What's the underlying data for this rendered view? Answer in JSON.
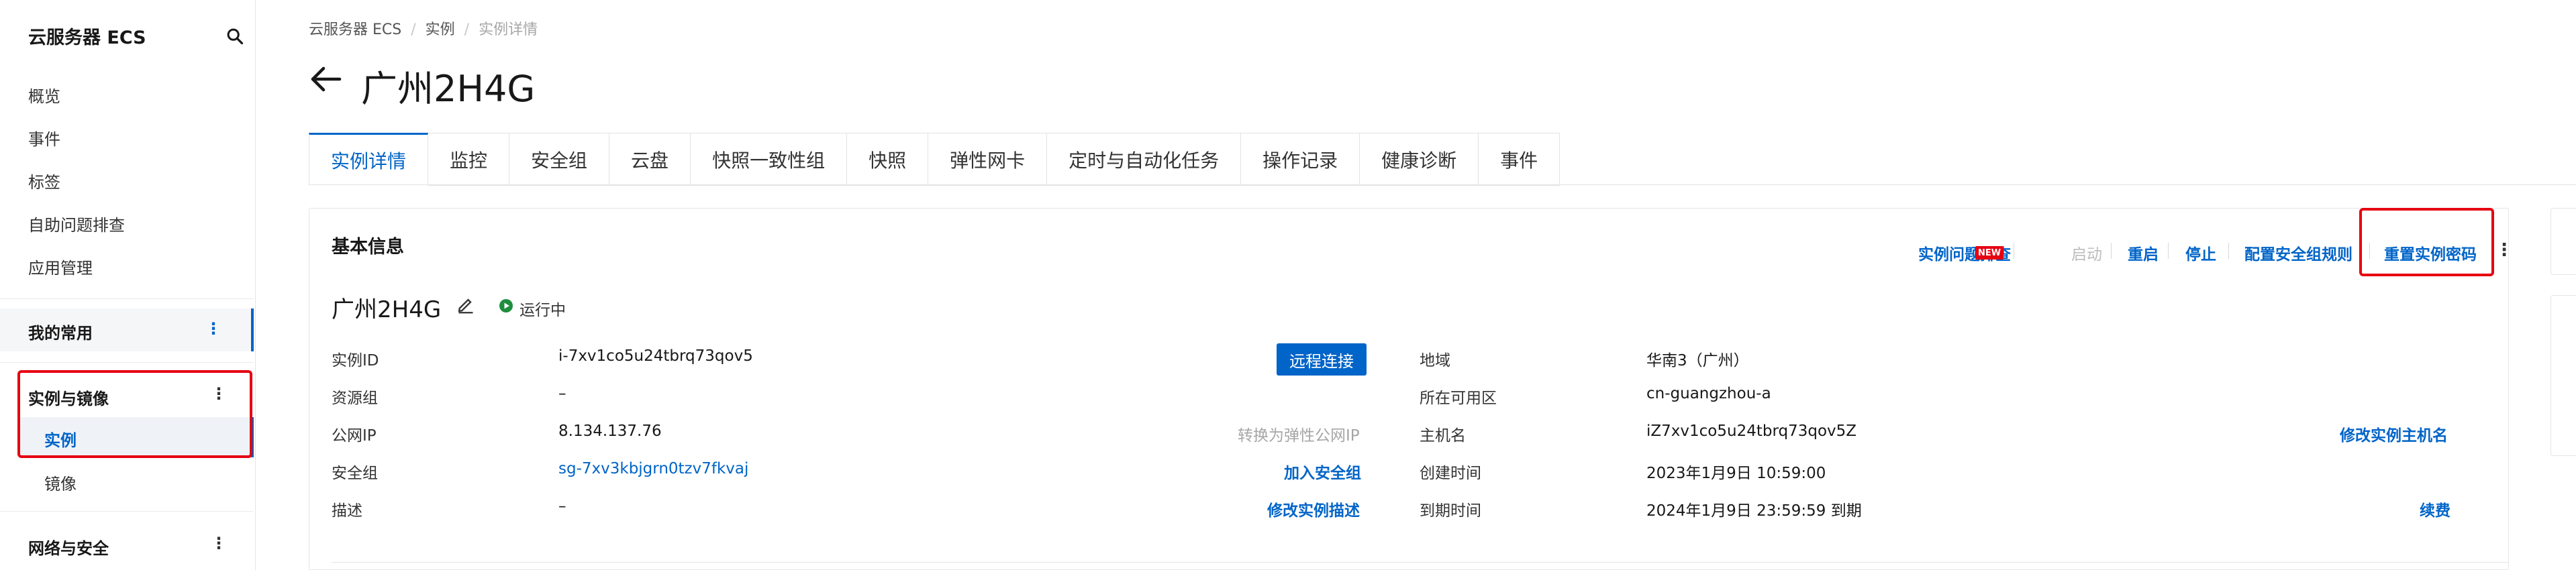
{
  "sidebar": {
    "title": "云服务器 ECS",
    "items": [
      "概览",
      "事件",
      "标签",
      "自助问题排查",
      "应用管理"
    ],
    "groups": {
      "favorites": "我的常用",
      "instances_images": "实例与镜像",
      "network_security": "网络与安全"
    },
    "sub_items": {
      "instance": "实例",
      "image": "镜像"
    }
  },
  "breadcrumb": {
    "items": [
      "云服务器 ECS",
      "实例",
      "实例详情"
    ]
  },
  "page": {
    "title": "广州2H4G"
  },
  "tabs": [
    "实例详情",
    "监控",
    "安全组",
    "云盘",
    "快照一致性组",
    "快照",
    "弹性网卡",
    "定时与自动化任务",
    "操作记录",
    "健康诊断",
    "事件"
  ],
  "basic_info": {
    "title": "基本信息",
    "actions": {
      "troubleshoot": "实例问题排查",
      "new_badge": "NEW",
      "start": "启动",
      "restart": "重启",
      "stop": "停止",
      "config_sg_rules": "配置安全组规则",
      "reset_password": "重置实例密码"
    },
    "instance_name": "广州2H4G",
    "status": "运行中",
    "left_fields": {
      "instance_id_label": "实例ID",
      "instance_id": "i-7xv1co5u24tbrq73qov5",
      "remote_connect": "远程连接",
      "resource_group_label": "资源组",
      "resource_group": "–",
      "public_ip_label": "公网IP",
      "public_ip": "8.134.137.76",
      "convert_eip": "转换为弹性公网IP",
      "security_group_label": "安全组",
      "security_group": "sg-7xv3kbjgrn0tzv7fkvaj",
      "join_sg": "加入安全组",
      "description_label": "描述",
      "description": "–",
      "edit_description": "修改实例描述"
    },
    "right_fields": {
      "region_label": "地域",
      "region": "华南3（广州）",
      "zone_label": "所在可用区",
      "zone": "cn-guangzhou-a",
      "hostname_label": "主机名",
      "hostname": "iZ7xv1co5u24tbrq73qov5Z",
      "edit_hostname": "修改实例主机名",
      "created_label": "创建时间",
      "created": "2023年1月9日 10:59:00",
      "expire_label": "到期时间",
      "expire": "2024年1月9日 23:59:59 到期",
      "renew": "续费"
    }
  },
  "colors": {
    "accent": "#0064c8",
    "highlight": "#e60012",
    "running": "#1e8e3e"
  }
}
